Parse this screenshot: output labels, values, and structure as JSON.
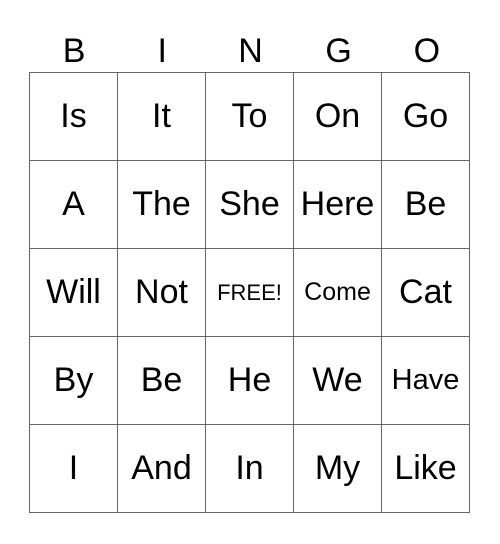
{
  "header": [
    "B",
    "I",
    "N",
    "G",
    "O"
  ],
  "rows": [
    [
      "Is",
      "It",
      "To",
      "On",
      "Go"
    ],
    [
      "A",
      "The",
      "She",
      "Here",
      "Be"
    ],
    [
      "Will",
      "Not",
      "FREE!",
      "Come",
      "Cat"
    ],
    [
      "By",
      "Be",
      "He",
      "We",
      "Have"
    ],
    [
      "I",
      "And",
      "In",
      "My",
      "Like"
    ]
  ]
}
